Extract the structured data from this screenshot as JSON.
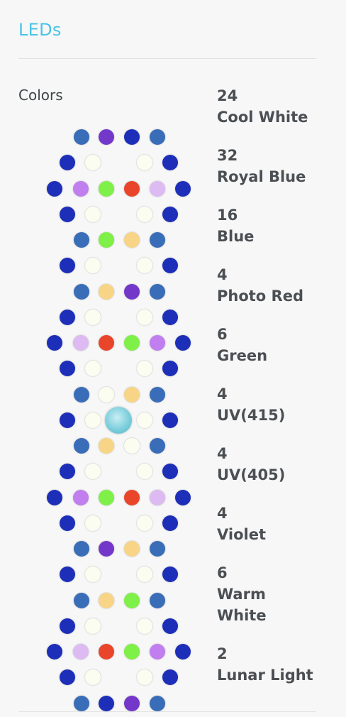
{
  "title": "LEDs",
  "colors_label": "Colors",
  "legend": [
    {
      "count": "24",
      "name_lines": [
        "Cool White"
      ]
    },
    {
      "count": "32",
      "name_lines": [
        "Royal Blue"
      ]
    },
    {
      "count": "16",
      "name_lines": [
        "Blue"
      ]
    },
    {
      "count": "4",
      "name_lines": [
        "Photo Red"
      ]
    },
    {
      "count": "6",
      "name_lines": [
        "Green"
      ]
    },
    {
      "count": "4",
      "name_lines": [
        "UV(415)"
      ]
    },
    {
      "count": "4",
      "name_lines": [
        "UV(405)"
      ]
    },
    {
      "count": "4",
      "name_lines": [
        "Violet"
      ]
    },
    {
      "count": "6",
      "name_lines": [
        "Warm",
        "White"
      ]
    },
    {
      "count": "2",
      "name_lines": [
        "Lunar Light"
      ]
    }
  ],
  "led_colors": {
    "cool_white": "#fbfdf1",
    "royal_blue": "#1d2fb8",
    "blue": "#3a6db8",
    "photo_red": "#e9452a",
    "green": "#7ef047",
    "uv415": "#c07eee",
    "uv405": "#ddbbf2",
    "violet": "#7338c9",
    "warm_white": "#f8d586",
    "lunar": "#6fc9d8"
  },
  "led_rows": [
    [
      "blue",
      "violet",
      "royal_blue",
      "blue"
    ],
    [
      "royal_blue",
      "cool_white",
      "cool_white",
      "royal_blue"
    ],
    [
      "royal_blue",
      "uv415",
      "green",
      "photo_red",
      "uv405",
      "royal_blue"
    ],
    [
      "royal_blue",
      "cool_white",
      "cool_white",
      "royal_blue"
    ],
    [
      "blue",
      "green",
      "warm_white",
      "blue"
    ],
    [
      "royal_blue",
      "cool_white",
      "cool_white",
      "royal_blue"
    ],
    [
      "blue",
      "warm_white",
      "violet",
      "blue"
    ],
    [
      "royal_blue",
      "cool_white",
      "cool_white",
      "royal_blue"
    ],
    [
      "royal_blue",
      "uv405",
      "photo_red",
      "green",
      "uv415",
      "royal_blue"
    ],
    [
      "royal_blue",
      "cool_white",
      "cool_white",
      "royal_blue"
    ],
    [
      "blue",
      "cool_white",
      "warm_white",
      "blue"
    ],
    [
      "royal_blue",
      "cool_white",
      "lunar",
      "cool_white",
      "royal_blue"
    ],
    [
      "blue",
      "warm_white",
      "cool_white",
      "blue"
    ],
    [
      "royal_blue",
      "cool_white",
      "cool_white",
      "royal_blue"
    ],
    [
      "royal_blue",
      "uv415",
      "green",
      "photo_red",
      "uv405",
      "royal_blue"
    ],
    [
      "royal_blue",
      "cool_white",
      "cool_white",
      "royal_blue"
    ],
    [
      "blue",
      "violet",
      "warm_white",
      "blue"
    ],
    [
      "royal_blue",
      "cool_white",
      "cool_white",
      "royal_blue"
    ],
    [
      "blue",
      "warm_white",
      "green",
      "blue"
    ],
    [
      "royal_blue",
      "cool_white",
      "cool_white",
      "royal_blue"
    ],
    [
      "royal_blue",
      "uv405",
      "photo_red",
      "green",
      "uv415",
      "royal_blue"
    ],
    [
      "royal_blue",
      "cool_white",
      "cool_white",
      "royal_blue"
    ],
    [
      "blue",
      "royal_blue",
      "violet",
      "blue"
    ]
  ]
}
